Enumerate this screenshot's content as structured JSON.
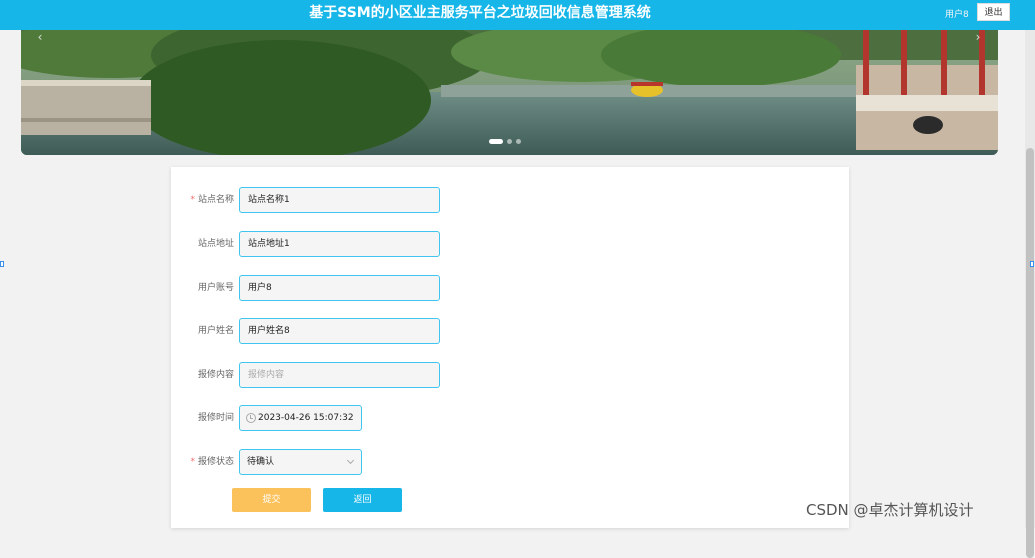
{
  "header": {
    "title": "基于SSM的小区业主服务平台之垃圾回收信息管理系统",
    "user_label": "用户8",
    "logout_label": "退出"
  },
  "carousel": {
    "prev_icon": "‹",
    "next_icon": "›",
    "dot_count": 3,
    "active_index": 0
  },
  "form": {
    "fields": [
      {
        "label": "站点名称",
        "required": true,
        "value": "站点名称1",
        "placeholder": ""
      },
      {
        "label": "站点地址",
        "required": false,
        "value": "站点地址1",
        "placeholder": ""
      },
      {
        "label": "用户账号",
        "required": false,
        "value": "用户8",
        "placeholder": ""
      },
      {
        "label": "用户姓名",
        "required": false,
        "value": "用户姓名8",
        "placeholder": ""
      },
      {
        "label": "报修内容",
        "required": false,
        "value": "",
        "placeholder": "报修内容"
      }
    ],
    "repair_time": {
      "label": "报修时间",
      "value": "2023-04-26 15:07:32",
      "icon": "clock-icon"
    },
    "repair_status": {
      "label": "报修状态",
      "required": true,
      "value": "待确认",
      "icon": "chevron-down-icon"
    },
    "submit_label": "提交",
    "back_label": "返回",
    "required_mark": "*"
  },
  "watermark": "CSDN @卓杰计算机设计",
  "colors": {
    "header": "#17b6e8",
    "submit": "#fbc15a",
    "back": "#17b6e8",
    "field_border": "#3fc5ef"
  }
}
